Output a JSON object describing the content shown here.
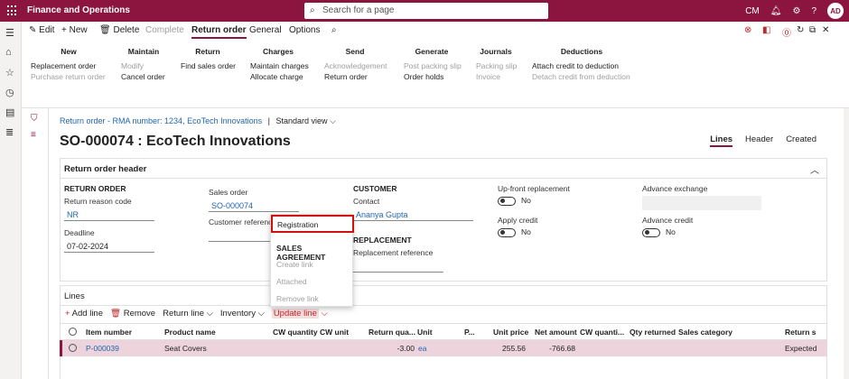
{
  "app": {
    "title": "Finance and Operations",
    "search_placeholder": "Search for a page",
    "initials": "CM",
    "avatar": "AD"
  },
  "toolbar": {
    "edit": "Edit",
    "new": "New",
    "delete": "Delete",
    "complete": "Complete",
    "tabs": [
      "Return order",
      "General",
      "Options"
    ]
  },
  "ribbon": {
    "groups": [
      {
        "header": "New",
        "items": [
          {
            "label": "Replacement order",
            "enabled": true
          },
          {
            "label": "Purchase return order",
            "enabled": false
          }
        ]
      },
      {
        "header": "Maintain",
        "items": [
          {
            "label": "Modify",
            "enabled": false
          },
          {
            "label": "Cancel order",
            "enabled": true
          }
        ]
      },
      {
        "header": "Return",
        "items": [
          {
            "label": "Find sales order",
            "enabled": true
          }
        ]
      },
      {
        "header": "Charges",
        "items": [
          {
            "label": "Maintain charges",
            "enabled": true
          },
          {
            "label": "Allocate charge",
            "enabled": true
          }
        ]
      },
      {
        "header": "Send",
        "items": [
          {
            "label": "Acknowledgement",
            "enabled": false
          },
          {
            "label": "Return order",
            "enabled": true
          }
        ]
      },
      {
        "header": "Generate",
        "items": [
          {
            "label": "Post packing slip",
            "enabled": false
          },
          {
            "label": "Order holds",
            "enabled": true
          }
        ]
      },
      {
        "header": "Journals",
        "items": [
          {
            "label": "Packing slip",
            "enabled": false
          },
          {
            "label": "Invoice",
            "enabled": false
          }
        ]
      },
      {
        "header": "Deductions",
        "items": [
          {
            "label": "Attach credit to deduction",
            "enabled": true
          },
          {
            "label": "Detach credit from deduction",
            "enabled": false
          }
        ]
      }
    ]
  },
  "page": {
    "breadcrumb": "Return order - RMA number: 1234, EcoTech Innovations",
    "sep": "|",
    "view": "Standard view",
    "title": "SO-000074 : EcoTech Innovations",
    "view_tabs": [
      "Lines",
      "Header",
      "Created"
    ]
  },
  "header_panel": {
    "title": "Return order header",
    "return_order_label": "RETURN ORDER",
    "reason_label": "Return reason code",
    "reason_value": "NR",
    "deadline_label": "Deadline",
    "deadline_value": "07-02-2024",
    "sales_order_label": "Sales order",
    "sales_order_value": "SO-000074",
    "customer_ref_label": "Customer reference",
    "customer_label": "CUSTOMER",
    "contact_label": "Contact",
    "contact_value": "Ananya Gupta",
    "replacement_label": "REPLACEMENT",
    "replacement_ref_label": "Replacement reference",
    "upfront_label": "Up-front replacement",
    "upfront_value": "No",
    "apply_credit_label": "Apply credit",
    "apply_credit_value": "No",
    "adv_exchange_label": "Advance exchange",
    "adv_credit_label": "Advance credit",
    "adv_credit_value": "No"
  },
  "menu": {
    "highlight": "Registration",
    "section": "SALES AGREEMENT",
    "items": [
      "Create link",
      "Attached",
      "Remove link"
    ]
  },
  "lines": {
    "title": "Lines",
    "actions": [
      "Add line",
      "Remove",
      "Return line",
      "Inventory",
      "Update line"
    ],
    "columns": [
      "Item number",
      "Product name",
      "CW quantity",
      "CW unit",
      "Return qua...",
      "Unit",
      "P...",
      "Unit price",
      "Net amount",
      "CW quanti...",
      "Qty returned",
      "Sales category",
      "Return s"
    ],
    "row": {
      "item": "P-000039",
      "product": "Seat Covers",
      "qty": "-3.00",
      "unit": "ea",
      "unit_price": "255.56",
      "net_amount": "-766.68",
      "status": "Expected"
    }
  }
}
